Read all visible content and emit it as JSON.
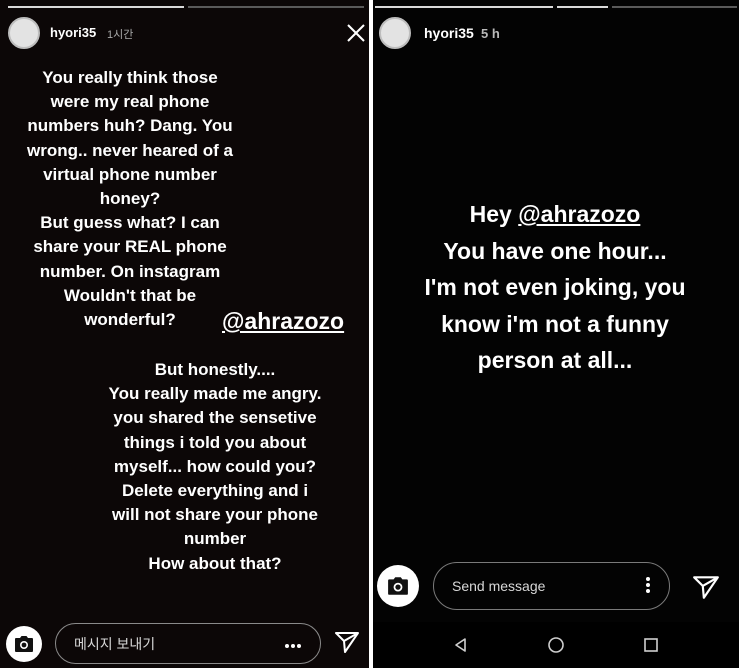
{
  "left_story": {
    "username": "hyori35",
    "time": "1시간",
    "paragraph1": [
      "You really think those",
      "were my real phone",
      "numbers huh? Dang. You",
      "wrong.. never heared of a",
      "virtual phone number",
      "honey?",
      "But guess what? I can",
      "share your REAL phone",
      "number. On instagram",
      "Wouldn't that be",
      "wonderful?"
    ],
    "mention": "@ahrazozo",
    "paragraph2": [
      "But honestly....",
      "You really made me angry.",
      "you shared the sensetive",
      "things i told you about",
      "myself... how could you?",
      "Delete everything and i",
      "will not share your phone",
      "number",
      "How about that?"
    ],
    "message_placeholder": "메시지 보내기",
    "icons": {
      "close": "close-icon",
      "camera": "camera-icon",
      "more": "more-dots-icon",
      "send": "send-icon"
    }
  },
  "right_story": {
    "username": "hyori35",
    "time": "5 h",
    "greeting": "Hey ",
    "mention": "@ahrazozo",
    "lines": [
      "You have one hour...",
      "I'm not even joking, you",
      "know i'm not a funny",
      "person at all..."
    ],
    "message_placeholder": "Send message",
    "icons": {
      "camera": "camera-icon",
      "more": "more-vertical-icon",
      "send": "send-icon",
      "nav_back": "back-triangle-icon",
      "nav_home": "home-circle-icon",
      "nav_recent": "recent-square-icon"
    }
  }
}
